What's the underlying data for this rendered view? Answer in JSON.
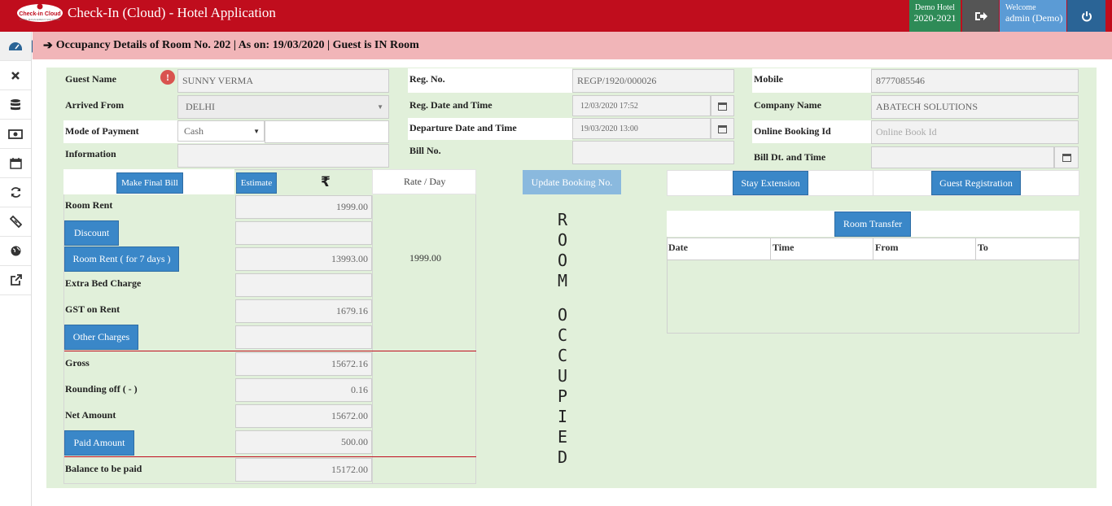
{
  "app": {
    "title": "Check-In (Cloud) - Hotel Application",
    "logo_text": "Check-in Cloud",
    "logo_tagline": "HOTEL MANAGEMENT SOFTWARE"
  },
  "topbar": {
    "hotel_name": "Demo Hotel",
    "fiscal_year": "2020-2021",
    "welcome_label": "Welcome",
    "user": "admin (Demo)"
  },
  "header": {
    "text": "Occupancy Details of Room No. 202 | As on: 19/03/2020 | Guest is IN Room"
  },
  "sidebar": {
    "items": [
      "dashboard-icon",
      "close-icon",
      "database-icon",
      "money-icon",
      "calendar-icon",
      "refresh-icon",
      "ticket-icon",
      "globe-icon",
      "external-link-icon"
    ]
  },
  "guest": {
    "name_label": "Guest Name",
    "name_value": "SUNNY VERMA",
    "arrived_label": "Arrived From",
    "arrived_value": "DELHI",
    "payment_label": "Mode of Payment",
    "payment_value": "Cash",
    "info_label": "Information",
    "info_value": ""
  },
  "registration": {
    "reg_no_label": "Reg. No.",
    "reg_no_value": "REGP/1920/000026",
    "reg_dt_label": "Reg. Date and Time",
    "reg_dt_value": "12/03/2020 17:52",
    "dep_label": "Departure Date and Time",
    "dep_value": "19/03/2020 13:00",
    "bill_label": "Bill No.",
    "bill_value": ""
  },
  "contact": {
    "mobile_label": "Mobile",
    "mobile_value": "8777085546",
    "company_label": "Company Name",
    "company_value": "ABATECH SOLUTIONS",
    "booking_label": "Online Booking Id",
    "booking_placeholder": "Online Book Id",
    "billdt_label": "Bill Dt. and Time",
    "billdt_value": ""
  },
  "billing": {
    "final_bill_btn": "Make Final Bill",
    "estimate_btn": "Estimate",
    "currency_symbol": "₹",
    "rate_day_label": "Rate / Day",
    "room_rent_label": "Room Rent",
    "room_rent_value": "1999.00",
    "discount_btn": "Discount",
    "discount_value": "",
    "room_rent_days_btn": "Room Rent ( for 7 days )",
    "room_rent_days_value": "13993.00",
    "rate_day_value": "1999.00",
    "extra_bed_label": "Extra Bed Charge",
    "extra_bed_value": "",
    "gst_label": "GST on Rent",
    "gst_value": "1679.16",
    "other_btn": "Other Charges",
    "other_value": "",
    "gross_label": "Gross",
    "gross_value": "15672.16",
    "rounding_label": "Rounding off ( - )",
    "rounding_value": "0.16",
    "net_label": "Net Amount",
    "net_value": "15672.00",
    "paid_btn": "Paid Amount",
    "paid_value": "500.00",
    "balance_label": "Balance to be paid",
    "balance_value": "15172.00"
  },
  "actions": {
    "update_booking_btn": "Update Booking No.",
    "stay_extension_btn": "Stay Extension",
    "guest_registration_btn": "Guest Registration",
    "room_transfer_btn": "Room Transfer"
  },
  "status": {
    "letters": [
      "R",
      "O",
      "O",
      "M",
      "",
      "O",
      "C",
      "C",
      "U",
      "P",
      "I",
      "E",
      "D"
    ]
  },
  "transfer_table": {
    "columns": [
      "Date",
      "Time",
      "From",
      "To"
    ],
    "rows": []
  }
}
